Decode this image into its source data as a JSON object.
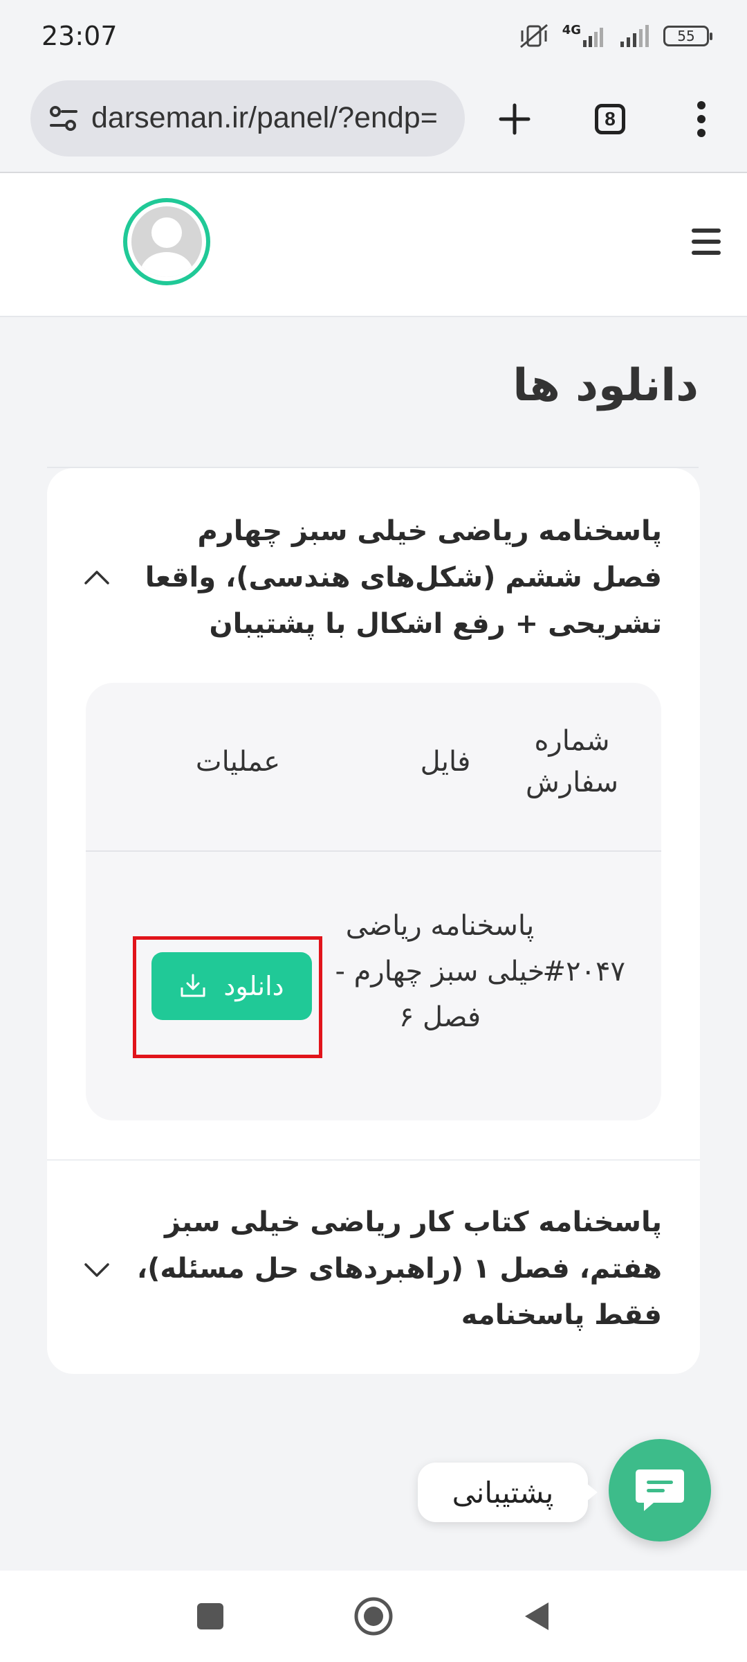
{
  "status_bar": {
    "time": "23:07",
    "network": "4G",
    "battery": "55"
  },
  "browser": {
    "url": "darseman.ir/panel/?endp=",
    "tab_count": "8"
  },
  "page": {
    "title": "دانلود ها"
  },
  "accordion": [
    {
      "title": "پاسخنامه ریاضی خیلی سبز چهارم فصل ششم (شکل‌های هندسی)، واقعا تشریحی + رفع اشکال با پشتیبان",
      "expanded": true,
      "table": {
        "headers": {
          "order": "شماره سفارش",
          "file": "فایل",
          "actions": "عملیات"
        },
        "rows": [
          {
            "order": "#۲۰۴۷",
            "file": "پاسخنامه ریاضی خیلی سبز چهارم - فصل ۶",
            "action_label": "دانلود"
          }
        ]
      }
    },
    {
      "title": "پاسخنامه کتاب کار ریاضی خیلی سبز هفتم، فصل ۱ (راهبردهای حل مسئله)، فقط پاسخنامه",
      "expanded": false
    }
  ],
  "support": {
    "label": "پشتیبانی"
  },
  "colors": {
    "accent": "#20c997",
    "support": "#3dbc8a",
    "highlight": "#e1141b"
  }
}
